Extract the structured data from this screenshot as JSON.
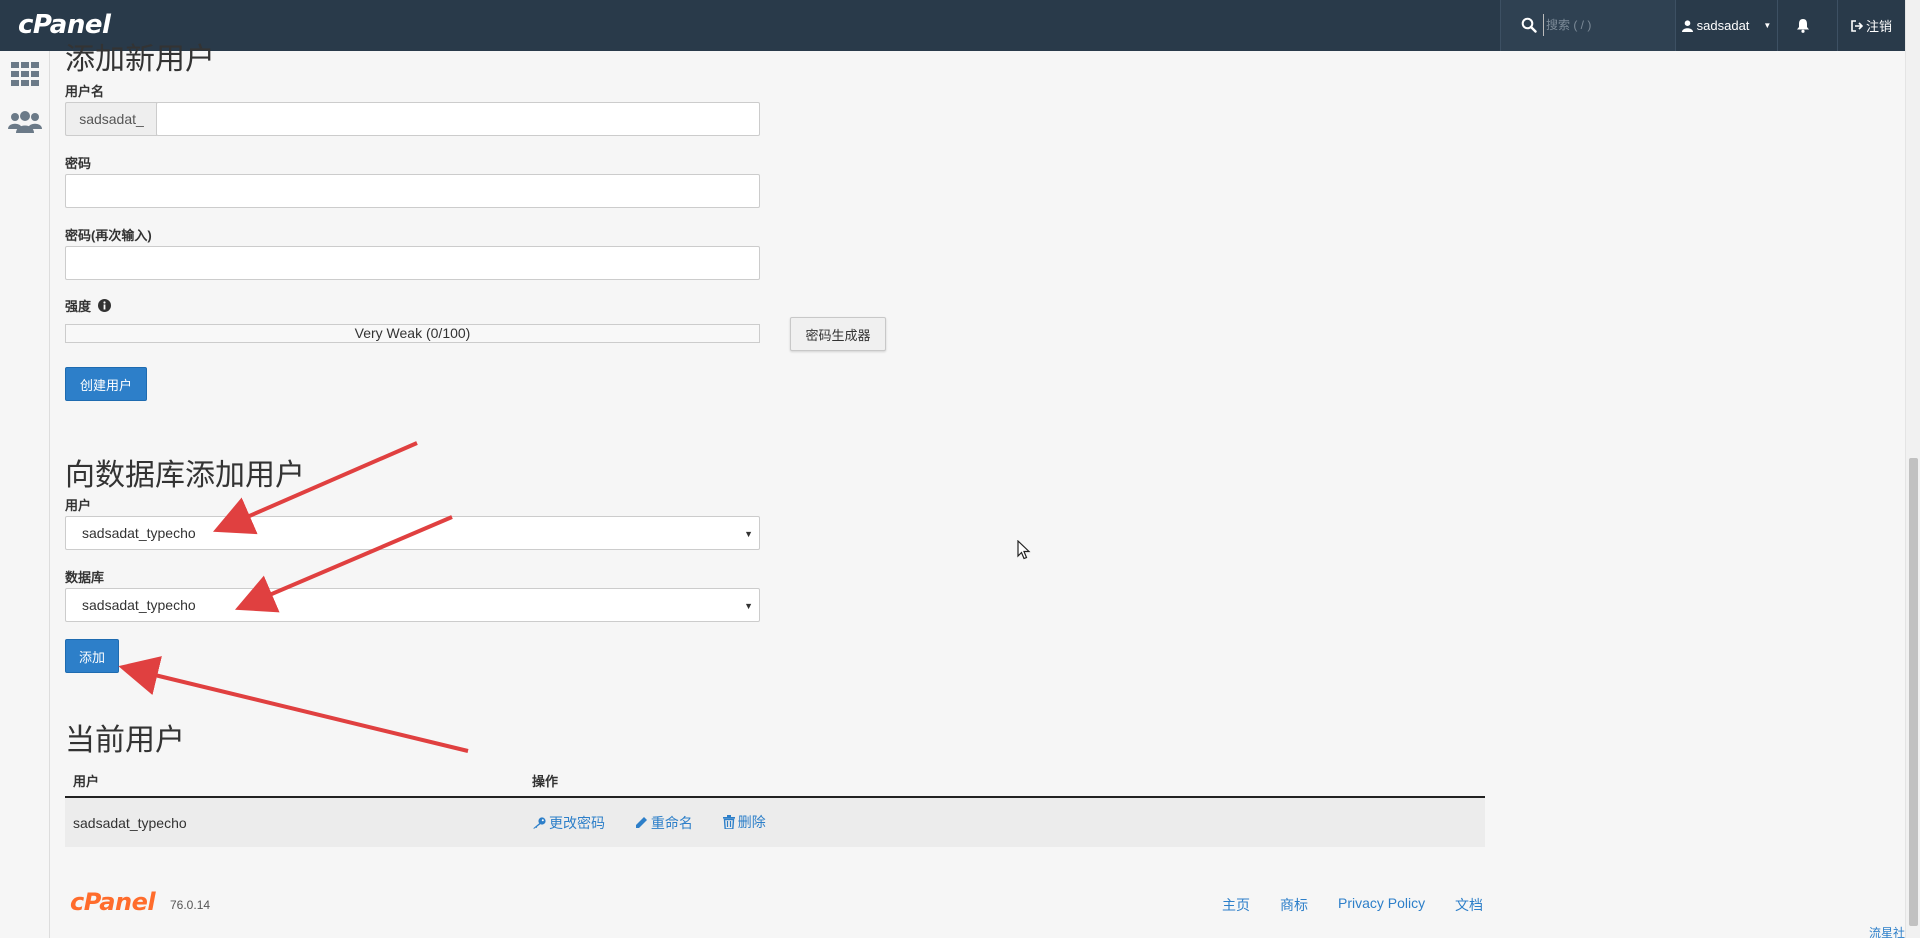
{
  "header": {
    "logo": "cPanel",
    "search_placeholder": "搜索 ( / )",
    "username": "sadsadat",
    "logout_label": "注销"
  },
  "add_user": {
    "title": "添加新用户",
    "username_label": "用户名",
    "username_prefix": "sadsadat_",
    "username_value": "",
    "password_label": "密码",
    "password_again_label": "密码(再次输入)",
    "strength_label": "强度",
    "strength_text": "Very Weak (0/100)",
    "strength_value": 0,
    "generator_button": "密码生成器",
    "create_button": "创建用户"
  },
  "add_to_db": {
    "title": "向数据库添加用户",
    "user_label": "用户",
    "user_selected": "sadsadat_typecho",
    "database_label": "数据库",
    "database_selected": "sadsadat_typecho",
    "add_button": "添加"
  },
  "current_users": {
    "title": "当前用户",
    "columns": [
      "用户",
      "操作"
    ],
    "rows": [
      {
        "user": "sadsadat_typecho",
        "actions": [
          "更改密码",
          "重命名",
          "删除"
        ]
      }
    ]
  },
  "footer": {
    "logo": "cPanel",
    "version": "76.0.14",
    "links": [
      "主页",
      "商标",
      "Privacy Policy",
      "文档"
    ],
    "corner_text": "流星社区"
  },
  "colors": {
    "topbar": "#293a4a",
    "primary": "#2d7fc9",
    "annotation_arrow": "#e04040",
    "brand_orange": "#ff6c2c"
  }
}
